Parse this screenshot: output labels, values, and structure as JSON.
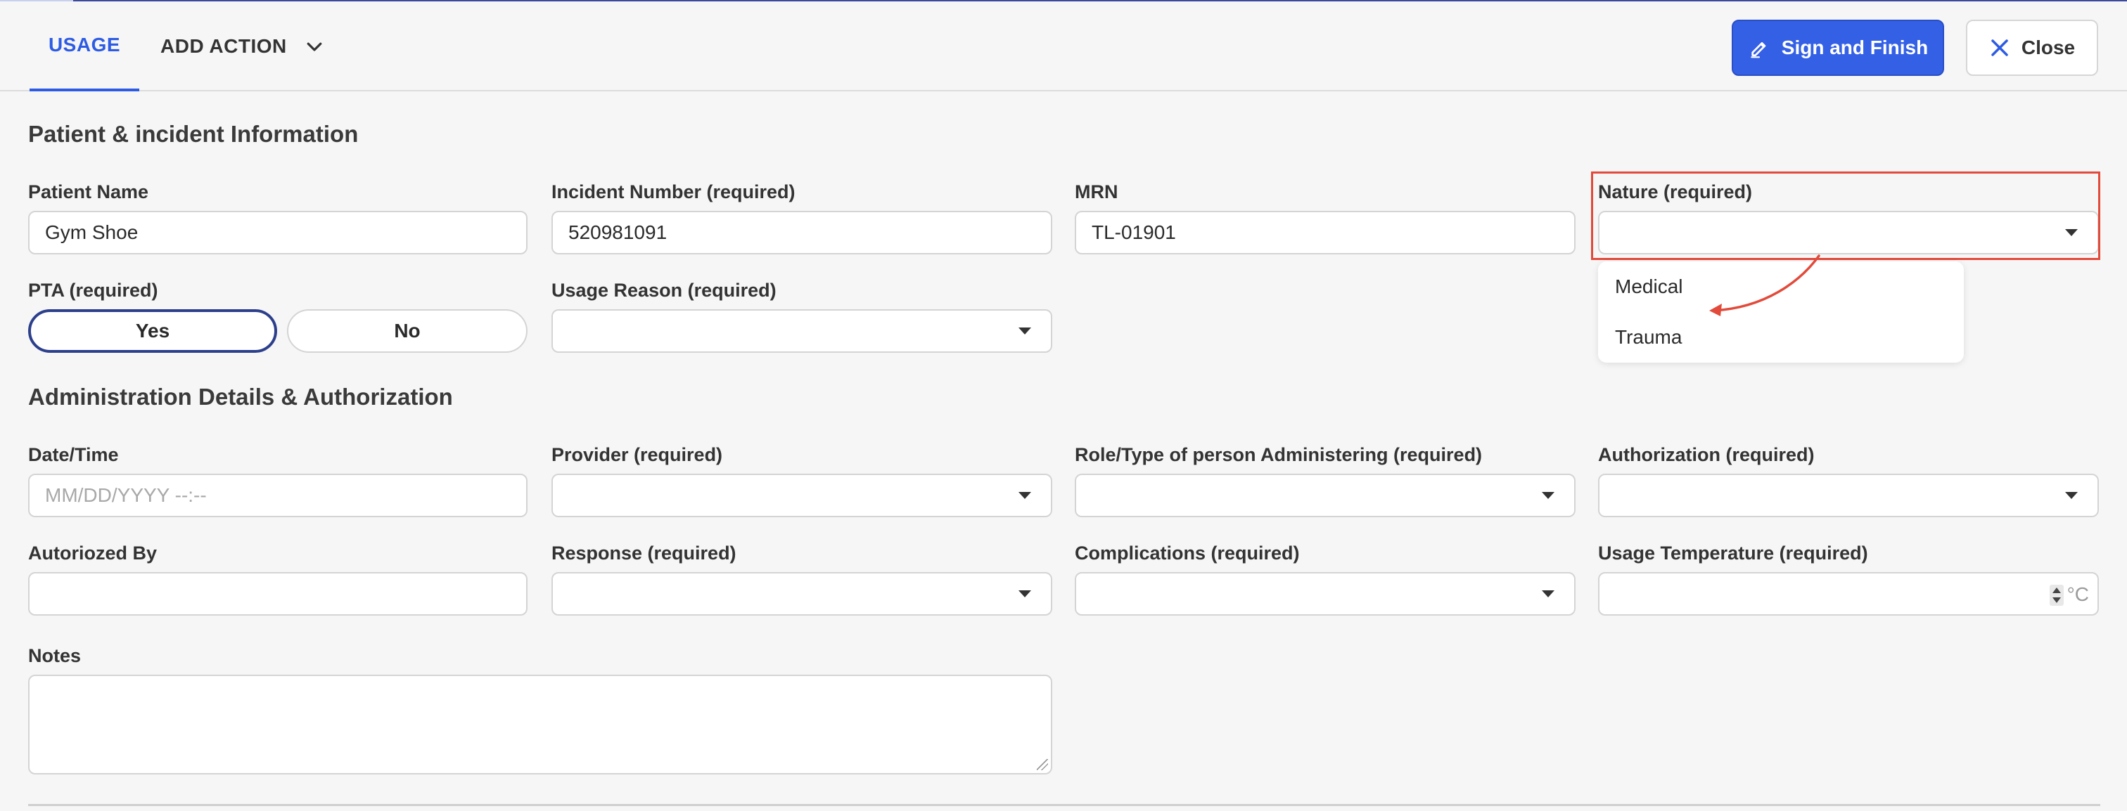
{
  "header": {
    "tabs": [
      {
        "label": "USAGE",
        "active": true
      },
      {
        "label": "ADD ACTION",
        "active": false
      }
    ],
    "sign_button": "Sign and Finish",
    "close_button": "Close"
  },
  "patient_section": {
    "title": "Patient & incident Information",
    "patient_name": {
      "label": "Patient Name",
      "value": "Gym Shoe"
    },
    "incident_number": {
      "label": "Incident Number (required)",
      "value": "520981091"
    },
    "mrn": {
      "label": "MRN",
      "value": "TL-01901"
    },
    "nature": {
      "label": "Nature (required)",
      "value": "",
      "options": [
        "Medical",
        "Trauma"
      ]
    },
    "pta": {
      "label": "PTA (required)",
      "options": [
        "Yes",
        "No"
      ],
      "selected": "Yes"
    },
    "usage_reason": {
      "label": "Usage Reason (required)",
      "value": ""
    }
  },
  "admin_section": {
    "title": "Administration Details & Authorization",
    "datetime": {
      "label": "Date/Time",
      "placeholder": "MM/DD/YYYY --:--"
    },
    "provider": {
      "label": "Provider (required)",
      "value": ""
    },
    "role": {
      "label": "Role/Type of person Administering (required)",
      "value": ""
    },
    "authorization": {
      "label": "Authorization (required)",
      "value": ""
    },
    "authorized_by": {
      "label": "Autoriozed By",
      "value": ""
    },
    "response": {
      "label": "Response (required)",
      "value": ""
    },
    "complications": {
      "label": "Complications (required)",
      "value": ""
    },
    "temperature": {
      "label": "Usage Temperature (required)",
      "value": "",
      "unit": "°C"
    },
    "notes": {
      "label": "Notes",
      "value": ""
    }
  },
  "colors": {
    "accent": "#2d5be3",
    "primary_button": "#3460e6",
    "highlight": "#e24a3b",
    "selected_toggle_border": "#2c3f8c"
  }
}
